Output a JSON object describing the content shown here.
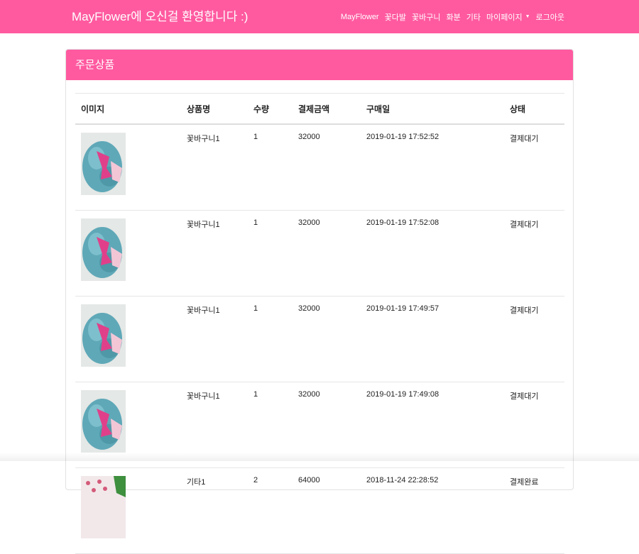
{
  "navbar": {
    "brand": "MayFlower에 오신걸 환영합니다 :)",
    "menu": [
      {
        "label": "MayFlower"
      },
      {
        "label": "꽃다발"
      },
      {
        "label": "꽃바구니"
      },
      {
        "label": "화분"
      },
      {
        "label": "기타"
      },
      {
        "label": "마이페이지",
        "dropdown": true
      },
      {
        "label": "로그아웃"
      }
    ]
  },
  "panel": {
    "title": "주문상품"
  },
  "table": {
    "headers": {
      "image": "이미지",
      "name": "상품명",
      "qty": "수량",
      "amount": "결제금액",
      "date": "구매일",
      "status": "상태"
    },
    "rows": [
      {
        "thumb": "bouquet-basket-thumb",
        "name": "꽃바구니1",
        "qty": "1",
        "amount": "32000",
        "date": "2019-01-19 17:52:52",
        "status": "결제대기"
      },
      {
        "thumb": "bouquet-basket-thumb",
        "name": "꽃바구니1",
        "qty": "1",
        "amount": "32000",
        "date": "2019-01-19 17:52:08",
        "status": "결제대기"
      },
      {
        "thumb": "bouquet-basket-thumb",
        "name": "꽃바구니1",
        "qty": "1",
        "amount": "32000",
        "date": "2019-01-19 17:49:57",
        "status": "결제대기"
      },
      {
        "thumb": "bouquet-basket-thumb",
        "name": "꽃바구니1",
        "qty": "1",
        "amount": "32000",
        "date": "2019-01-19 17:49:08",
        "status": "결제대기"
      },
      {
        "thumb": "etc-item-thumb",
        "name": "기타1",
        "qty": "2",
        "amount": "64000",
        "date": "2018-11-24 22:28:52",
        "status": "결제완료"
      }
    ]
  },
  "colors": {
    "brand_pink": "#ff5aa0"
  }
}
